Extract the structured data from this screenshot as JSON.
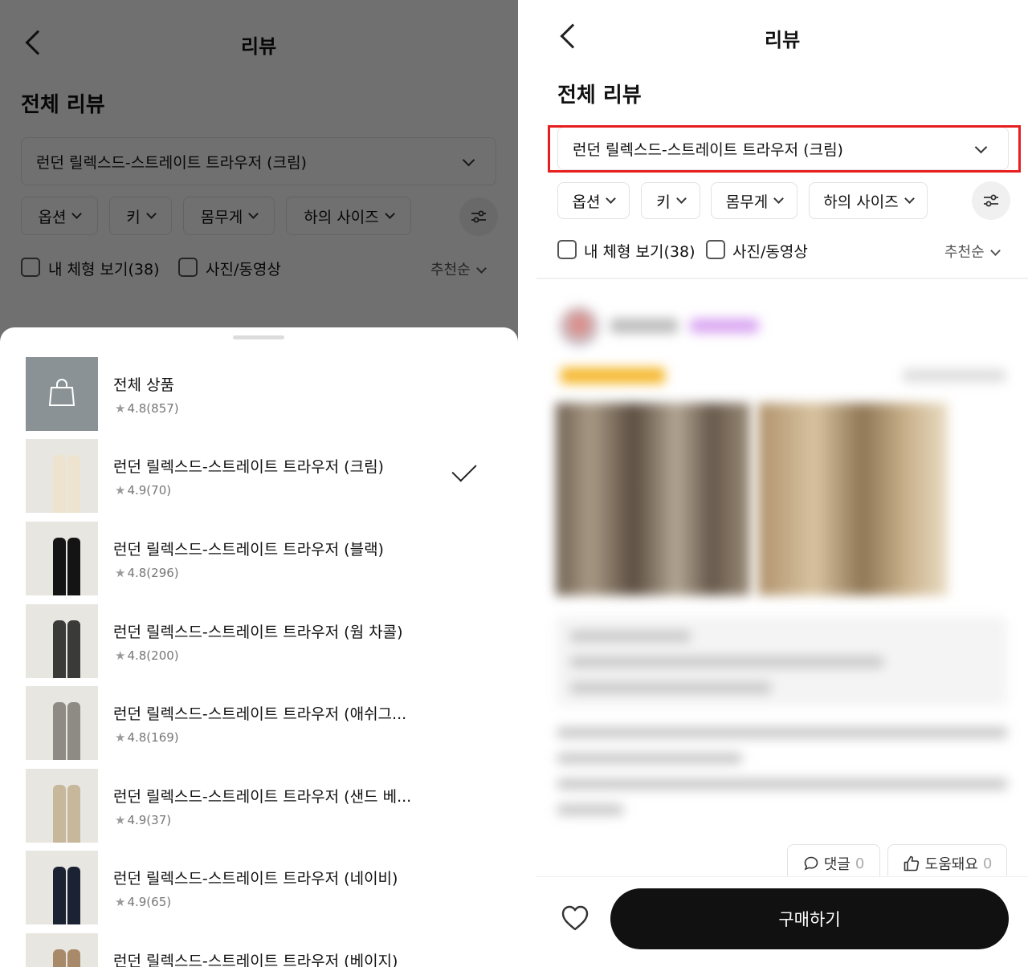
{
  "header": {
    "title": "리뷰"
  },
  "section_title": "전체 리뷰",
  "product_select": {
    "selected": "런던 릴렉스드-스트레이트 트라우저 (크림)"
  },
  "filters": [
    {
      "label": "옵션"
    },
    {
      "label": "키"
    },
    {
      "label": "몸무게"
    },
    {
      "label": "하의 사이즈"
    }
  ],
  "checkboxes": [
    {
      "label": "내 체형 보기(38)"
    },
    {
      "label": "사진/동영상"
    }
  ],
  "sort": {
    "label": "추천순"
  },
  "product_sheet": {
    "items": [
      {
        "name": "전체 상품",
        "rating": "4.8(857)",
        "selected": false,
        "thumb": "bag"
      },
      {
        "name": "런던 릴렉스드-스트레이트 트라우저 (크림)",
        "rating": "4.9(70)",
        "selected": true,
        "thumb": "#ede3cf"
      },
      {
        "name": "런던 릴렉스드-스트레이트 트라우저 (블랙)",
        "rating": "4.8(296)",
        "selected": false,
        "thumb": "#141414"
      },
      {
        "name": "런던 릴렉스드-스트레이트 트라우저 (웜 차콜)",
        "rating": "4.8(200)",
        "selected": false,
        "thumb": "#3a3a38"
      },
      {
        "name": "런던 릴렉스드-스트레이트 트라우저 (애쉬그...",
        "rating": "4.8(169)",
        "selected": false,
        "thumb": "#8e8a84"
      },
      {
        "name": "런던 릴렉스드-스트레이트 트라우저 (샌드 베...",
        "rating": "4.9(37)",
        "selected": false,
        "thumb": "#c7b89c"
      },
      {
        "name": "런던 릴렉스드-스트레이트 트라우저 (네이비)",
        "rating": "4.9(65)",
        "selected": false,
        "thumb": "#1b2233"
      },
      {
        "name": "런던 릴렉스드-스트레이트 트라우저 (베이지)",
        "rating": "",
        "selected": false,
        "thumb": "#a88a6a"
      }
    ]
  },
  "review": {
    "comment_label": "댓글",
    "comment_count": "0",
    "helpful_label": "도움돼요",
    "helpful_count": "0"
  },
  "bottom_bar": {
    "buy_label": "구매하기"
  },
  "colors": {
    "highlight": "#e61e1e",
    "buy_button": "#111111",
    "star": "#9a9a9a"
  }
}
